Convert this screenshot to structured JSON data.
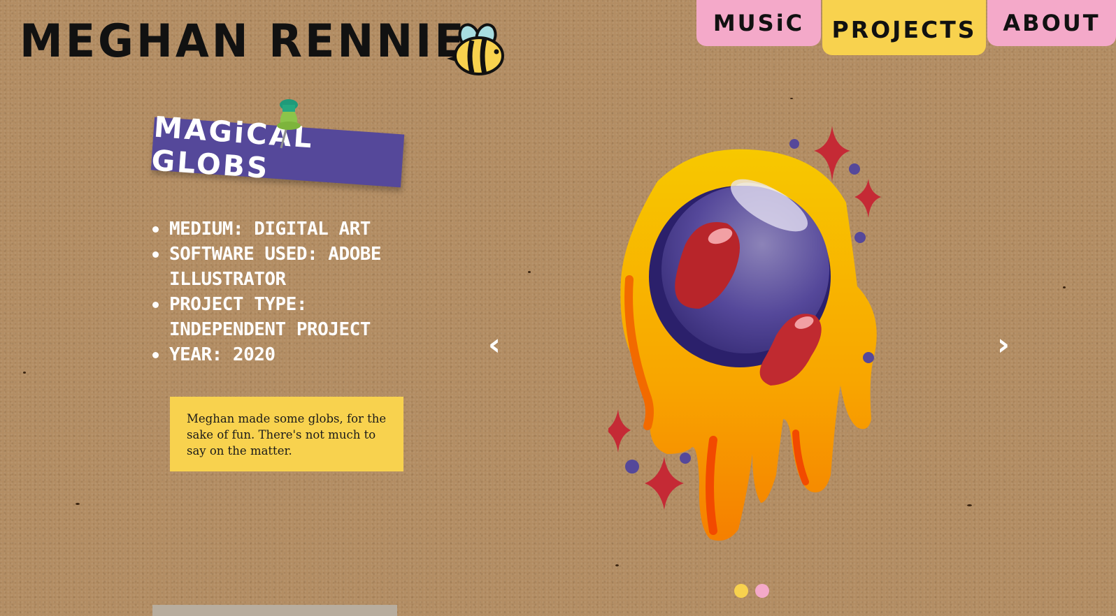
{
  "site": {
    "title": "MEGHAN RENNIE",
    "logo_icon": "bee-icon"
  },
  "nav": {
    "tabs": [
      {
        "label": "MUSiC",
        "color": "#f4a9c9"
      },
      {
        "label": "PROJECTS",
        "color": "#f8d24e",
        "active": true
      },
      {
        "label": "ABOUT",
        "color": "#f4a9c9"
      }
    ]
  },
  "project": {
    "title": "MAGiCAL GLOBS",
    "title_color": "#55489a",
    "pin_icon": "pushpin-icon",
    "specs": [
      "MEDIUM: DIGITAL ART",
      "SOFTWARE USED: ADOBE ILLUSTRATOR",
      "PROJECT TYPE: INDEPENDENT PROJECT",
      "YEAR: 2020"
    ],
    "description": "Meghan made some globs, for the sake of fun. There's not much to say on the matter."
  },
  "carousel": {
    "prev_label": "‹",
    "next_label": "›",
    "slide_image": "magical-glob-artwork",
    "slide_count": 2,
    "active_slide": 1,
    "dot_colors": [
      "#f8d24e",
      "#f4a9c9"
    ]
  },
  "colors": {
    "background": "#b38d63",
    "accent_yellow": "#f8d24e",
    "accent_pink": "#f4a9c9",
    "accent_purple": "#55489a"
  }
}
